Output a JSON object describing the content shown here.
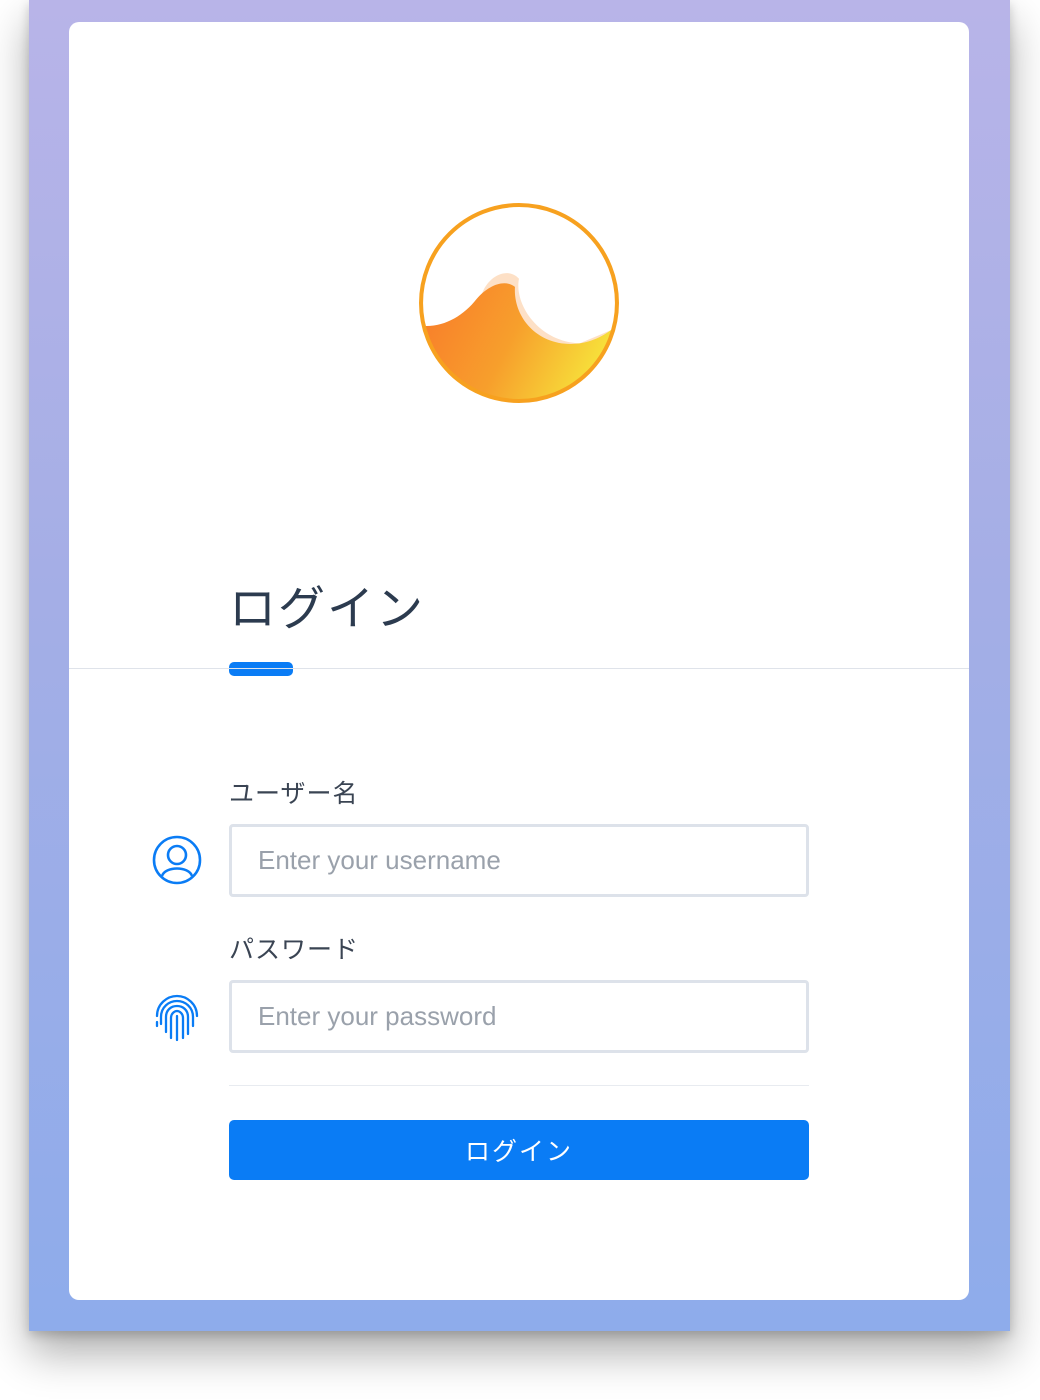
{
  "colors": {
    "accent": "#0a7cf5",
    "logo_ring": "#f7a11f",
    "logo_wave_start": "#f9782a",
    "logo_wave_end": "#f7e03a",
    "logo_crest": "#fde0c6"
  },
  "logo": {
    "icon": "wave-logo-icon"
  },
  "login": {
    "title": "ログイン",
    "username": {
      "label": "ユーザー名",
      "placeholder": "Enter your username",
      "value": "",
      "icon": "user-icon"
    },
    "password": {
      "label": "パスワード",
      "placeholder": "Enter your password",
      "value": "",
      "icon": "fingerprint-icon"
    },
    "submit_label": "ログイン"
  }
}
